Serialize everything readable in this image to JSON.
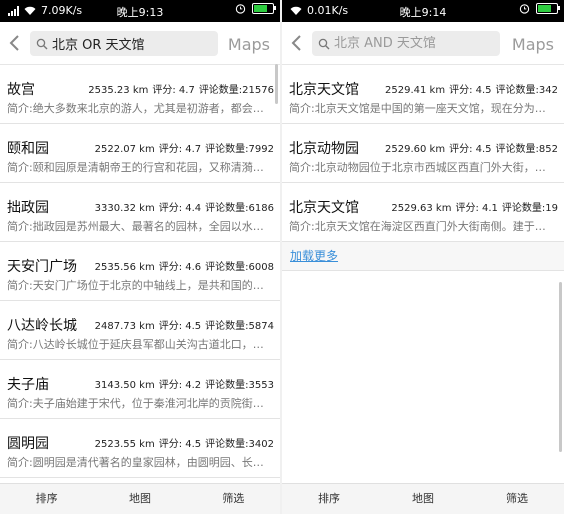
{
  "left": {
    "status": {
      "speed": "7.09K/s",
      "time": "晚上9:13"
    },
    "search": {
      "value": "北京 OR 天文馆",
      "placeholder": "北京 OR 天文馆"
    },
    "maps_label": "Maps",
    "results": [
      {
        "title": "故宫",
        "distance": "2535.23 km",
        "rating": "评分: 4.7",
        "reviews": "评论数量:21576",
        "desc": "简介:绝大多数来北京的游人，尤其是初游者，都会…"
      },
      {
        "title": "颐和园",
        "distance": "2522.07 km",
        "rating": "评分: 4.7",
        "reviews": "评论数量:7992",
        "desc": "简介:颐和园原是清朝帝王的行宫和花园，又称清漪…"
      },
      {
        "title": "拙政园",
        "distance": "3330.32 km",
        "rating": "评分: 4.4",
        "reviews": "评论数量:6186",
        "desc": "简介:拙政园是苏州最大、最著名的园林，全园以水…"
      },
      {
        "title": "天安门广场",
        "distance": "2535.56 km",
        "rating": "评分: 4.6",
        "reviews": "评论数量:6008",
        "desc": "简介:天安门广场位于北京的中轴线上，是共和国的…"
      },
      {
        "title": "八达岭长城",
        "distance": "2487.73 km",
        "rating": "评分: 4.5",
        "reviews": "评论数量:5874",
        "desc": "简介:八达岭长城位于延庆县军都山关沟古道北口，…"
      },
      {
        "title": "夫子庙",
        "distance": "3143.50 km",
        "rating": "评分: 4.2",
        "reviews": "评论数量:3553",
        "desc": "简介:夫子庙始建于宋代，位于秦淮河北岸的贡院街…"
      },
      {
        "title": "圆明园",
        "distance": "2523.55 km",
        "rating": "评分: 4.5",
        "reviews": "评论数量:3402",
        "desc": "简介:圆明园是清代著名的皇家园林，由圆明园、长…"
      }
    ],
    "bottom": {
      "sort": "排序",
      "map": "地图",
      "filter": "筛选"
    }
  },
  "right": {
    "status": {
      "speed": "0.01K/s",
      "time": "晚上9:14"
    },
    "search": {
      "value": "",
      "placeholder": "北京 AND 天文馆"
    },
    "maps_label": "Maps",
    "results": [
      {
        "title": "北京天文馆",
        "distance": "2529.41 km",
        "rating": "评分: 4.5",
        "reviews": "评论数量:342",
        "desc": "简介:北京天文馆是中国的第一座天文馆，现在分为…"
      },
      {
        "title": "北京动物园",
        "distance": "2529.60 km",
        "rating": "评分: 4.5",
        "reviews": "评论数量:852",
        "desc": "简介:北京动物园位于北京市西城区西直门外大街，…"
      },
      {
        "title": "北京天文馆",
        "distance": "2529.63 km",
        "rating": "评分: 4.1",
        "reviews": "评论数量:19",
        "desc": "简介:北京天文馆在海淀区西直门外大街南侧。建于…"
      }
    ],
    "load_more": "加载更多",
    "bottom": {
      "sort": "排序",
      "map": "地图",
      "filter": "筛选"
    }
  },
  "colors": {
    "link": "#3a8fd9",
    "battery": "#2ecc40",
    "statusbar": "#000000"
  },
  "icons": [
    "wifi-icon",
    "signal-icon",
    "alarm-clock-icon",
    "battery-icon",
    "back-arrow-icon",
    "search-icon"
  ]
}
